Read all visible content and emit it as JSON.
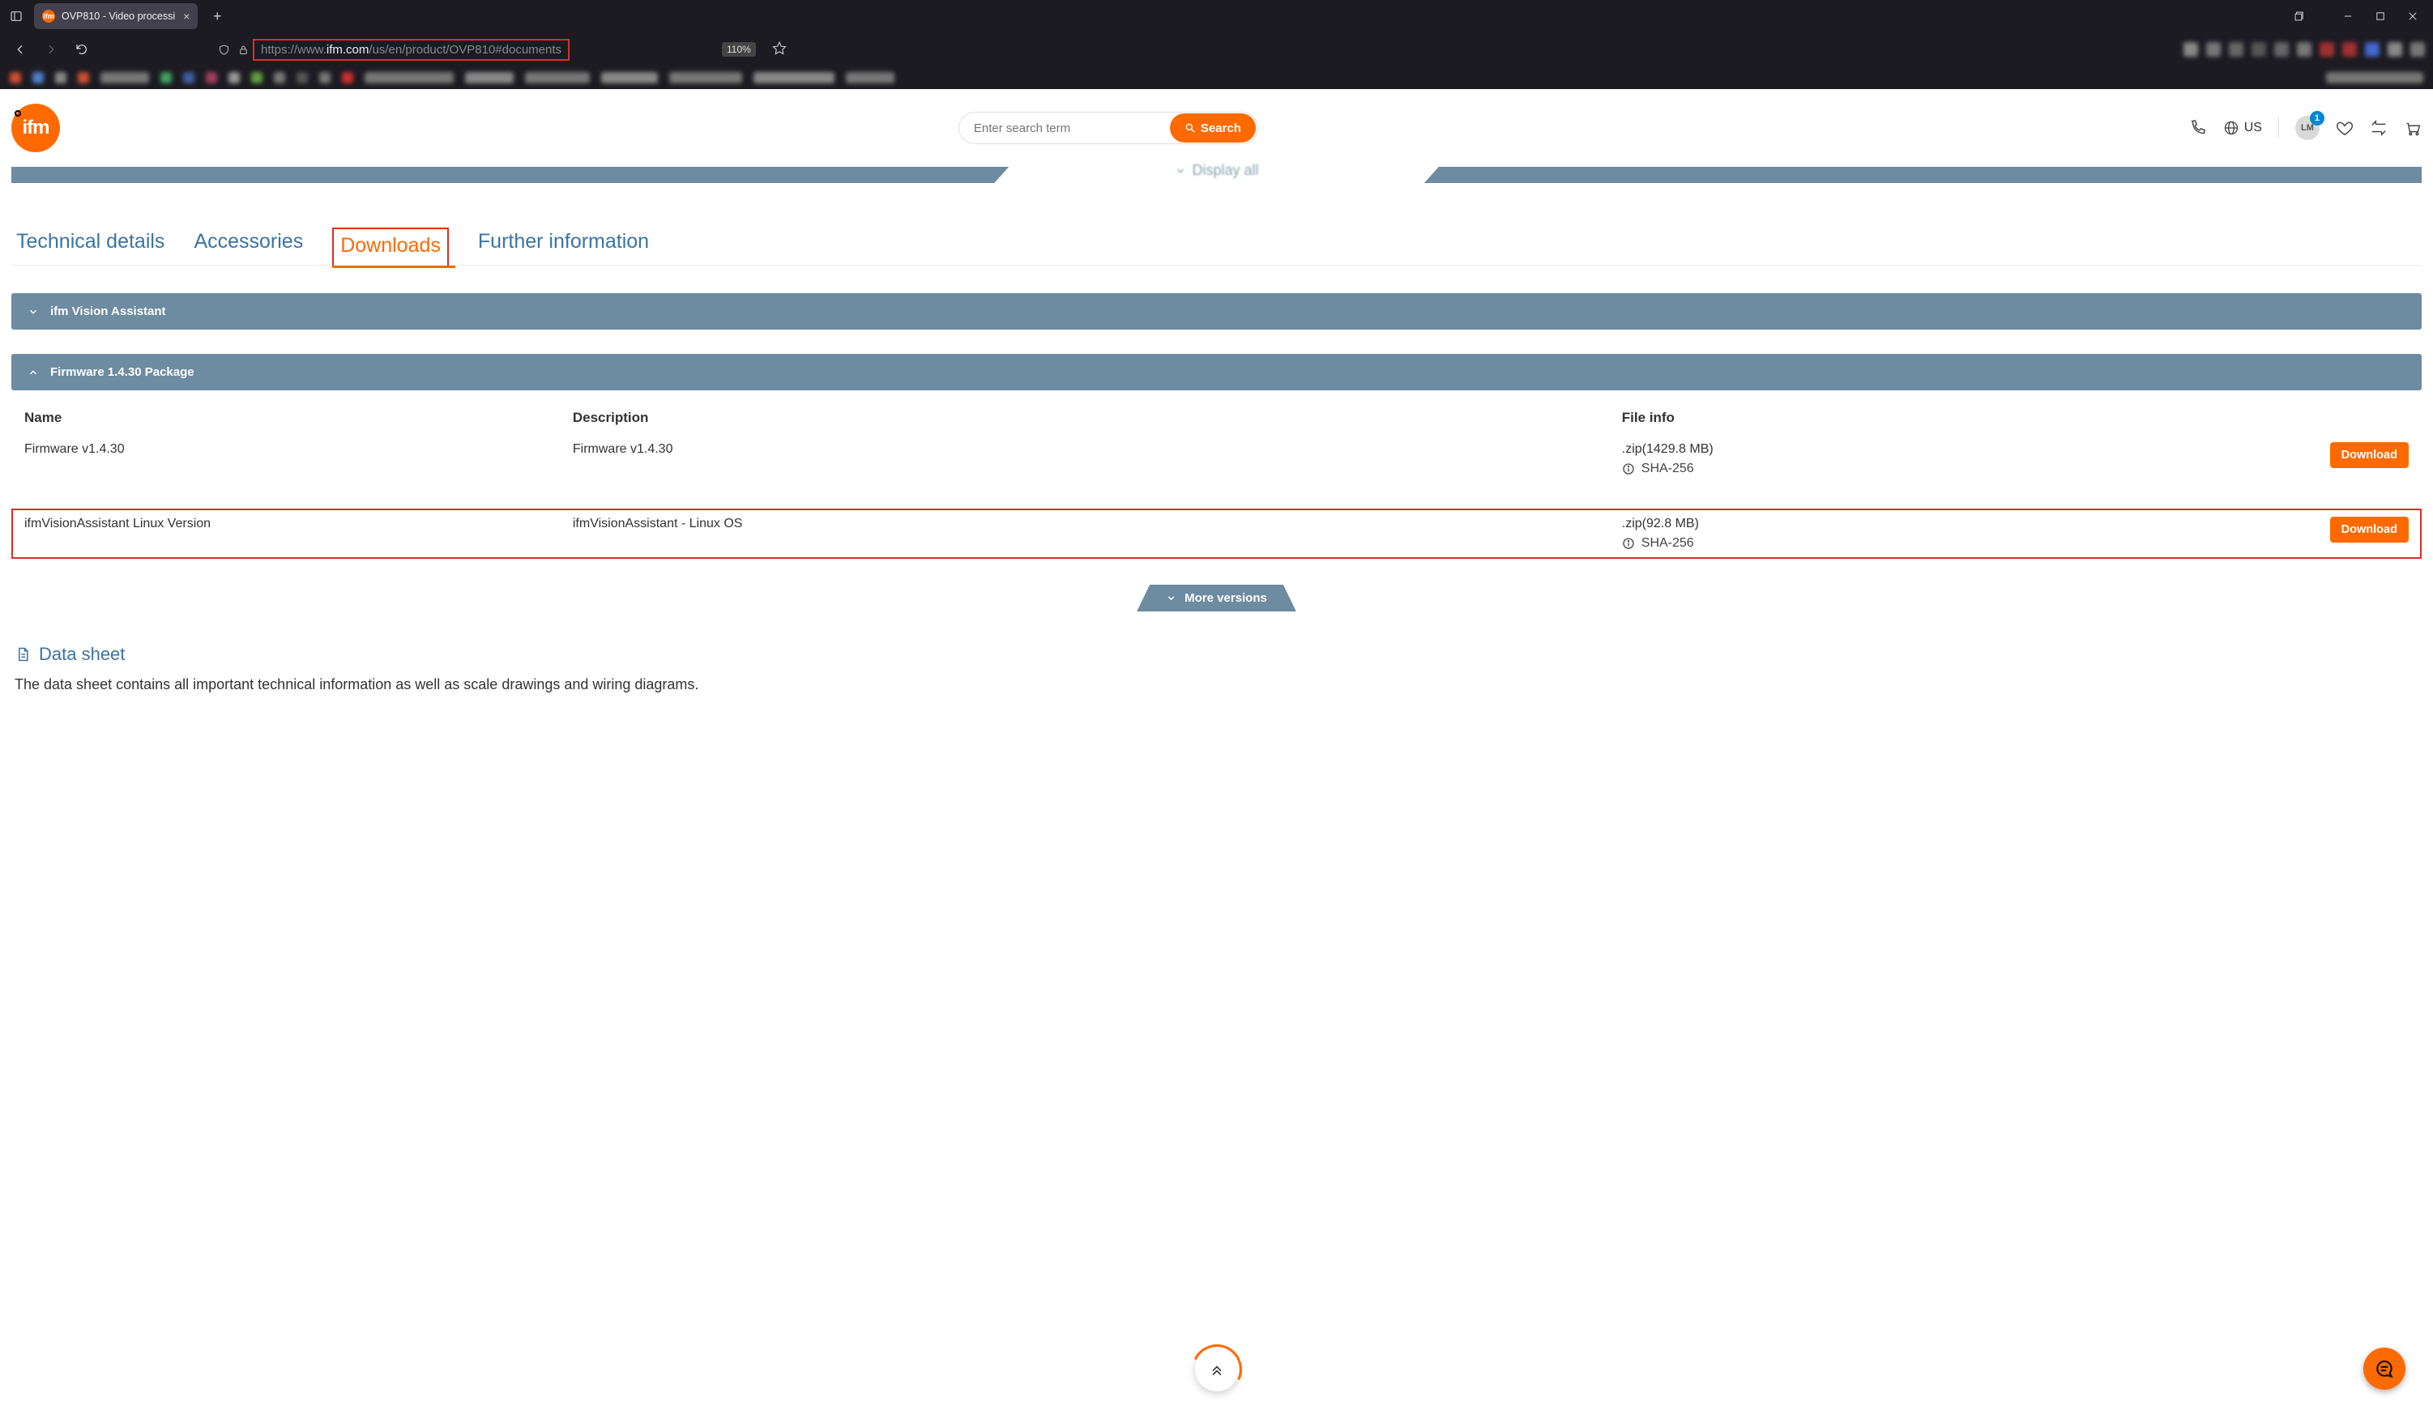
{
  "browser": {
    "tab_title": "OVP810 - Video processi",
    "url_prefix": "https://www.",
    "url_host": "ifm.com",
    "url_path": "/us/en/product/OVP810#documents",
    "zoom": "110%"
  },
  "header": {
    "search_placeholder": "Enter search term",
    "search_button": "Search",
    "lang": "US",
    "avatar_initials": "LM",
    "avatar_badge": "1"
  },
  "display_all": "Display all",
  "tabs": {
    "technical": "Technical details",
    "accessories": "Accessories",
    "downloads": "Downloads",
    "further": "Further information"
  },
  "accordions": {
    "vision": "ifm Vision Assistant",
    "firmware": "Firmware 1.4.30 Package"
  },
  "table": {
    "headers": {
      "name": "Name",
      "description": "Description",
      "fileinfo": "File info"
    },
    "rows": [
      {
        "name": "Firmware v1.4.30",
        "description": "Firmware v1.4.30",
        "fileinfo": ".zip(1429.8 MB)",
        "hash": "SHA-256",
        "download": "Download"
      },
      {
        "name": "ifmVisionAssistant Linux Version",
        "description": "ifmVisionAssistant - Linux OS",
        "fileinfo": ".zip(92.8 MB)",
        "hash": "SHA-256",
        "download": "Download"
      }
    ]
  },
  "more_versions": "More versions",
  "datasheet": {
    "title": "Data sheet",
    "body": "The data sheet contains all important technical information as well as scale drawings and wiring diagrams."
  }
}
